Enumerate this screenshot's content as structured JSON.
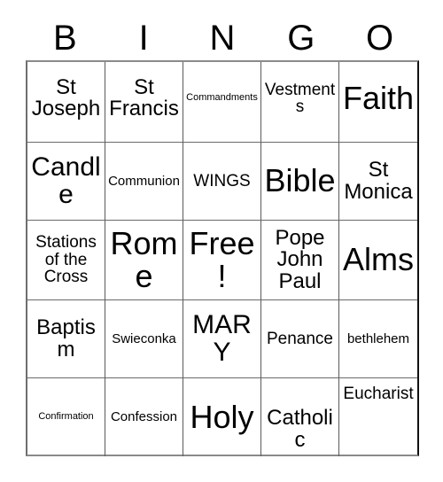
{
  "card": {
    "type": "bingo-card",
    "header_letters": [
      "B",
      "I",
      "N",
      "G",
      "O"
    ],
    "rows": 5,
    "columns": 5,
    "free_space": {
      "row": 3,
      "column": 3,
      "label": "Free!"
    },
    "colors": {
      "background": "#ffffff",
      "text": "#000000",
      "grid_line": "#5a5a5a",
      "outer_border": "#111111"
    },
    "cells": [
      [
        {
          "text": "St Joseph",
          "size": "lg",
          "align": "upper"
        },
        {
          "text": "St Francis",
          "size": "lg",
          "align": "upper"
        },
        {
          "text": "Commandments",
          "size": "xs",
          "align": "upper"
        },
        {
          "text": "Vestments",
          "size": "md",
          "align": "upper"
        },
        {
          "text": "Faith",
          "size": "xxl",
          "align": "upper"
        }
      ],
      [
        {
          "text": "Candle",
          "size": "xl",
          "align": "center"
        },
        {
          "text": "Communion",
          "size": "sm",
          "align": "center"
        },
        {
          "text": "WINGS",
          "size": "md",
          "align": "center"
        },
        {
          "text": "Bible",
          "size": "xxl",
          "align": "center"
        },
        {
          "text": "St Monica",
          "size": "lg",
          "align": "center"
        }
      ],
      [
        {
          "text": "Stations of the Cross",
          "size": "md",
          "align": "center"
        },
        {
          "text": "Rome",
          "size": "xxl",
          "align": "center"
        },
        {
          "text": "Free!",
          "size": "xxl",
          "align": "center"
        },
        {
          "text": "Pope John Paul",
          "size": "lg",
          "align": "center"
        },
        {
          "text": "Alms",
          "size": "xxl",
          "align": "center"
        }
      ],
      [
        {
          "text": "Baptism",
          "size": "lg",
          "align": "center"
        },
        {
          "text": "Swieconka",
          "size": "sm",
          "align": "center"
        },
        {
          "text": "MARY",
          "size": "xl",
          "align": "center"
        },
        {
          "text": "Penance",
          "size": "md",
          "align": "center"
        },
        {
          "text": "bethlehem",
          "size": "sm",
          "align": "center"
        }
      ],
      [
        {
          "text": "Confirmation",
          "size": "xs",
          "align": "center"
        },
        {
          "text": "Confession",
          "size": "sm",
          "align": "center"
        },
        {
          "text": "Holy",
          "size": "xxl",
          "align": "center"
        },
        {
          "text": "Catholic",
          "size": "lg",
          "align": "bottom"
        },
        {
          "text": "Eucharist",
          "size": "md",
          "align": "top"
        }
      ]
    ]
  }
}
